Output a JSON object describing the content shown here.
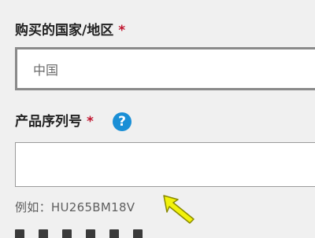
{
  "country_field": {
    "label": "购买的国家/地区",
    "required_mark": "*",
    "value": "中国"
  },
  "serial_field": {
    "label": "产品序列号",
    "required_mark": "*",
    "help_icon": "?",
    "value": "",
    "hint": "例如：HU265BM18V"
  },
  "colors": {
    "required": "#c0142e",
    "help_icon": "#1a8fd6",
    "cursor": "#f2f20a"
  },
  "icons": {
    "help": "question-circle-icon",
    "cursor": "mouse-pointer-arrow-icon"
  }
}
